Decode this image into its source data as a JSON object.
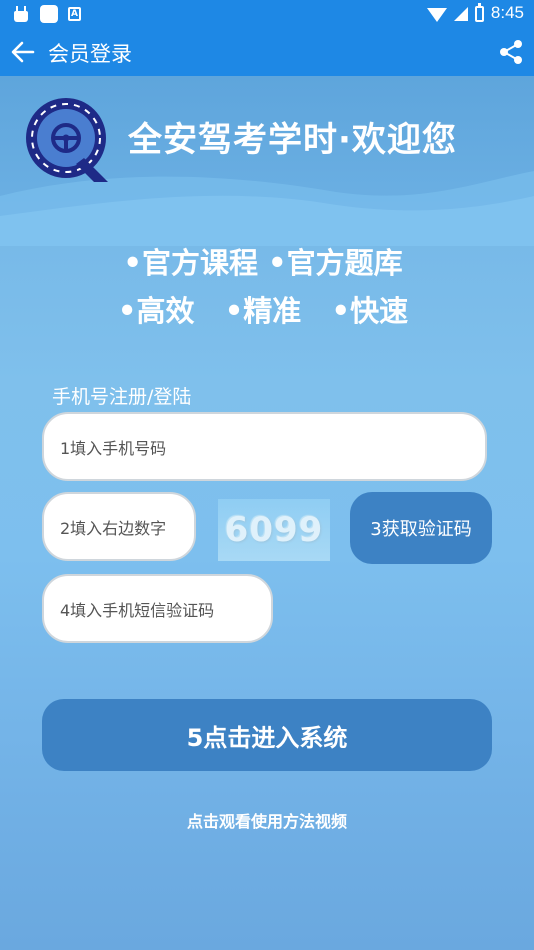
{
  "status_bar": {
    "time": "8:45"
  },
  "app_bar": {
    "title": "会员登录"
  },
  "hero": {
    "welcome_text": "全安驾考学时·欢迎您"
  },
  "features": {
    "line1": "•官方课程 •官方题库",
    "line2": "•高效   •精准   •快速"
  },
  "login": {
    "section_label": "手机号注册/登陆",
    "phone_placeholder": "1填入手机号码",
    "captcha_placeholder": "2填入右边数字",
    "captcha_value": "6099",
    "get_code_label": "3获取验证码",
    "sms_placeholder": "4填入手机短信验证码",
    "submit_label": "5点击进入系统",
    "video_link_label": "点击观看使用方法视频"
  },
  "colors": {
    "app_bar": "#1e88e5",
    "button": "#3d82c4",
    "background": "#74b6e6",
    "logo_navy": "#1e2a87"
  }
}
